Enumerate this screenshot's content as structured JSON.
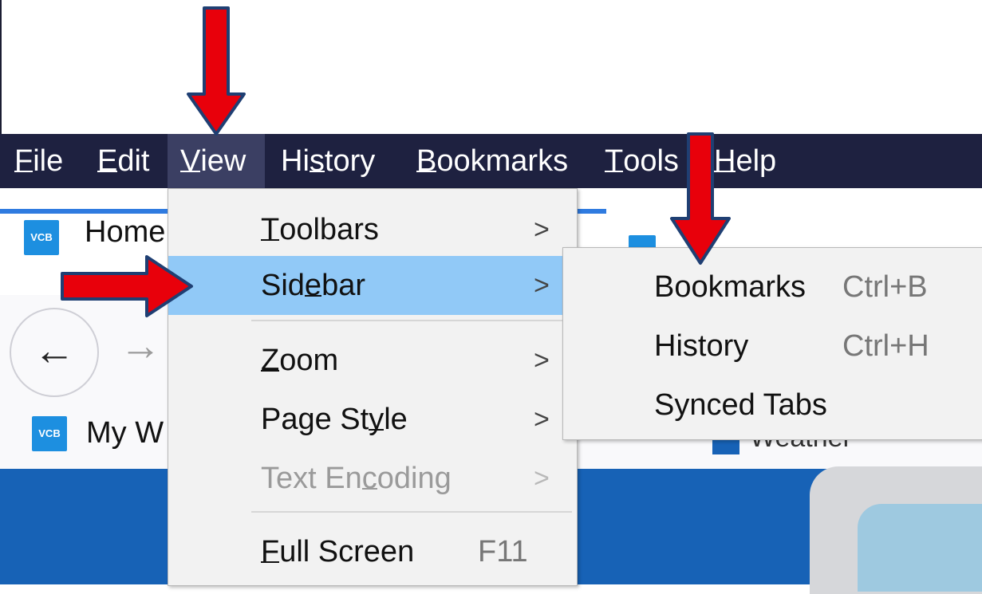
{
  "menubar": {
    "items": [
      {
        "label": "File",
        "accel_index": 0
      },
      {
        "label": "Edit",
        "accel_index": 0
      },
      {
        "label": "View",
        "accel_index": 0,
        "active": true
      },
      {
        "label": "History",
        "accel_index": 2
      },
      {
        "label": "Bookmarks",
        "accel_index": 0
      },
      {
        "label": "Tools",
        "accel_index": 0
      },
      {
        "label": "Help",
        "accel_index": 0
      }
    ]
  },
  "browser": {
    "tab_title": "Home",
    "bookmark_item": "My W",
    "favicon_text": "VCB",
    "back_glyph": "←",
    "forward_glyph": "→",
    "partial_bookmark_text": "Weather"
  },
  "view_menu": {
    "items": [
      {
        "label": "Toolbars",
        "accel_index": 0,
        "submenu": true
      },
      {
        "label": "Sidebar",
        "accel_index": 3,
        "submenu": true,
        "highlighted": true
      },
      {
        "label": "Zoom",
        "accel_index": 0,
        "submenu": true
      },
      {
        "label": "Page Style",
        "accel_index": 7,
        "submenu": true
      },
      {
        "label": "Text Encoding",
        "accel_index": 7,
        "submenu": true,
        "disabled": true
      },
      {
        "label": "Full Screen",
        "accel_index": 0,
        "shortcut": "F11"
      }
    ]
  },
  "sidebar_submenu": {
    "items": [
      {
        "label": "Bookmarks",
        "shortcut": "Ctrl+B"
      },
      {
        "label": "History",
        "shortcut": "Ctrl+H"
      },
      {
        "label": "Synced Tabs",
        "shortcut": ""
      }
    ]
  },
  "colors": {
    "menubar_bg": "#1e2140",
    "menu_highlight": "#91c9f7",
    "arrow": "#e8000b",
    "arrow_outline": "#1f3f73"
  }
}
